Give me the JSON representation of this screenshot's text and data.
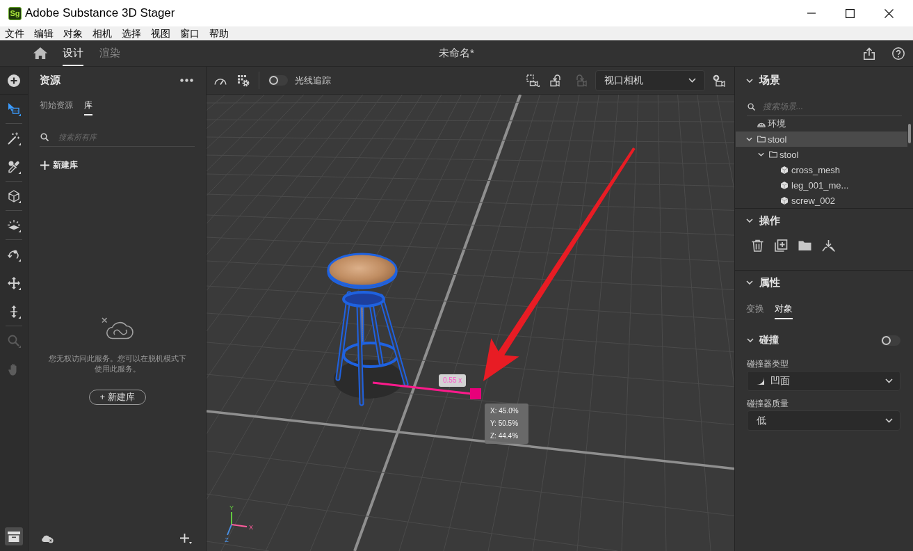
{
  "window": {
    "title": "Adobe Substance 3D Stager",
    "app_badge": "Sg"
  },
  "menu_bar": [
    "文件",
    "编辑",
    "对象",
    "相机",
    "选择",
    "视图",
    "窗口",
    "帮助"
  ],
  "header": {
    "tabs": [
      {
        "label": "设计",
        "selected": true
      },
      {
        "label": "渲染",
        "selected": false
      }
    ],
    "document_title": "未命名*"
  },
  "tool_rail": {
    "tool_groups": [
      [
        {
          "kind": "select",
          "selected": true,
          "disabled": false,
          "flyout": true
        }
      ],
      [
        {
          "kind": "wand",
          "selected": false,
          "disabled": false,
          "flyout": true
        },
        {
          "kind": "eyedropper",
          "selected": false,
          "disabled": false,
          "flyout": true
        }
      ],
      [
        {
          "kind": "cube",
          "selected": false,
          "disabled": false,
          "flyout": true
        }
      ],
      [
        {
          "kind": "light",
          "selected": false,
          "disabled": false,
          "flyout": true
        }
      ],
      [
        {
          "kind": "orbit",
          "selected": false,
          "disabled": false,
          "flyout": true
        },
        {
          "kind": "move",
          "selected": false,
          "disabled": false,
          "flyout": true
        },
        {
          "kind": "height",
          "selected": false,
          "disabled": false,
          "flyout": true
        }
      ],
      [
        {
          "kind": "zoom",
          "selected": false,
          "disabled": true,
          "flyout": true
        },
        {
          "kind": "hand",
          "selected": false,
          "disabled": true,
          "flyout": false
        }
      ]
    ],
    "assets_toggle": {
      "selected": true
    }
  },
  "assets_panel": {
    "title": "资源",
    "tabs": [
      {
        "label": "初始资源",
        "selected": false
      },
      {
        "label": "库",
        "selected": true
      }
    ],
    "search": {
      "placeholder": "搜索所有库"
    },
    "new_library_link": "新建库",
    "empty_message": "您无权访问此服务。您可以在脱机模式下使用此服务。",
    "new_library_button": "+ 新建库"
  },
  "viewport": {
    "toolbar": {
      "ray_tracing": {
        "label": "光线追踪",
        "on": false
      },
      "camera_tools": [
        {
          "kind": "frame",
          "disabled": false
        },
        {
          "kind": "undo",
          "disabled": false
        },
        {
          "kind": "redo",
          "disabled": true
        }
      ],
      "camera": {
        "value": "视口相机"
      }
    },
    "scale_gizmo": {
      "label": "0.55 x"
    },
    "position_readout": [
      {
        "axis": "X:",
        "value": "45.0%"
      },
      {
        "axis": "Y:",
        "value": "50.5%"
      },
      {
        "axis": "Z:",
        "value": "44.4%"
      }
    ],
    "axes": {
      "x": "X",
      "y": "Y",
      "z": "Z"
    }
  },
  "scene_panel": {
    "title": "场景",
    "expanded": true,
    "search": {
      "placeholder": "搜索场景..."
    },
    "tree": [
      {
        "label": "环境",
        "kind": "environment",
        "selected": false
      },
      {
        "label": "stool",
        "kind": "folder",
        "expanded": true,
        "selected": true,
        "children": [
          {
            "label": "stool",
            "kind": "folder",
            "expanded": true,
            "selected": false,
            "children": [
              {
                "label": "cross_mesh",
                "kind": "mesh",
                "selected": false
              },
              {
                "label": "leg_001_me...",
                "kind": "mesh",
                "selected": false
              },
              {
                "label": "screw_002",
                "kind": "mesh",
                "selected": false
              }
            ]
          }
        ]
      }
    ]
  },
  "actions_panel": {
    "title": "操作",
    "expanded": true,
    "actions": [
      {
        "kind": "delete"
      },
      {
        "kind": "duplicate"
      },
      {
        "kind": "group"
      },
      {
        "kind": "drop_to_floor"
      }
    ]
  },
  "properties_panel": {
    "title": "属性",
    "expanded": true,
    "tabs": [
      {
        "label": "变换",
        "selected": false
      },
      {
        "label": "对象",
        "selected": true
      }
    ],
    "collision": {
      "title": "碰撞",
      "expanded": true,
      "on": false,
      "fields": [
        {
          "label": "碰撞器类型",
          "value": "凹面",
          "kind": "shape"
        },
        {
          "label": "碰撞器质量",
          "value": "低",
          "kind": "plain"
        }
      ]
    }
  }
}
